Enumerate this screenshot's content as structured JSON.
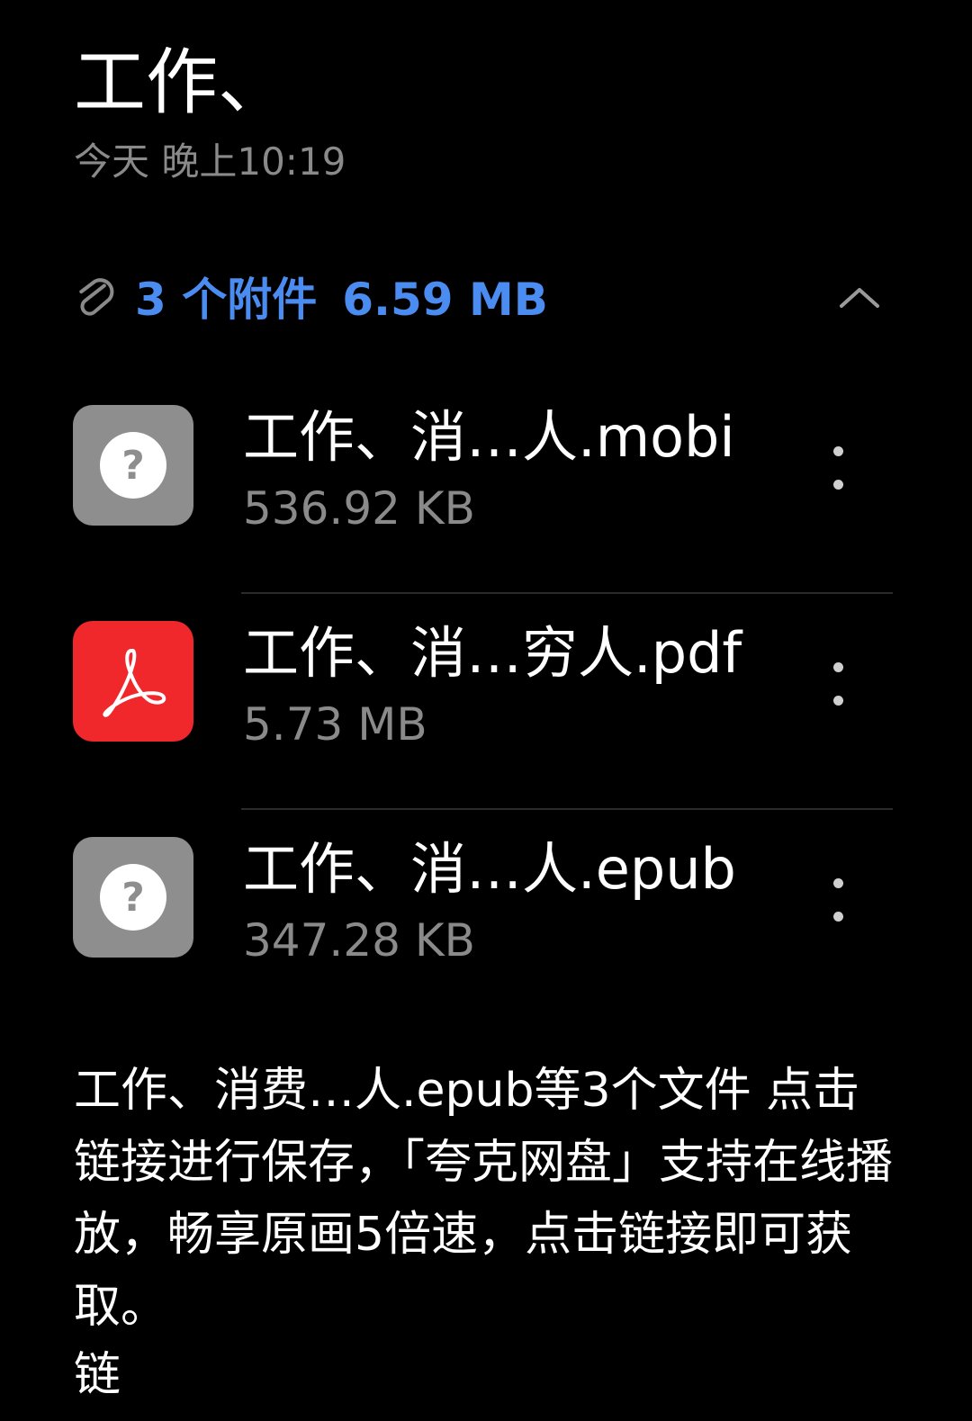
{
  "header": {
    "title": "工作、",
    "timestamp": "今天 晚上10:19"
  },
  "attachments": {
    "summary_count": "3 个附件",
    "summary_size": "6.59 MB",
    "accent_color": "#4a8cf0",
    "files": [
      {
        "name": "工作、消…人.mobi",
        "size": "536.92 KB",
        "icon": "unknown-file-icon"
      },
      {
        "name": "工作、消…穷人.pdf",
        "size": "5.73 MB",
        "icon": "pdf-icon"
      },
      {
        "name": "工作、消…人.epub",
        "size": "347.28 KB",
        "icon": "unknown-file-icon"
      }
    ]
  },
  "message": {
    "text": "工作、消费…人.epub等3个文件 点击链接进行保存，「夸克网盘」支持在线播放，畅享原画5倍速，点击链接即可获取。",
    "link_start": "链"
  }
}
